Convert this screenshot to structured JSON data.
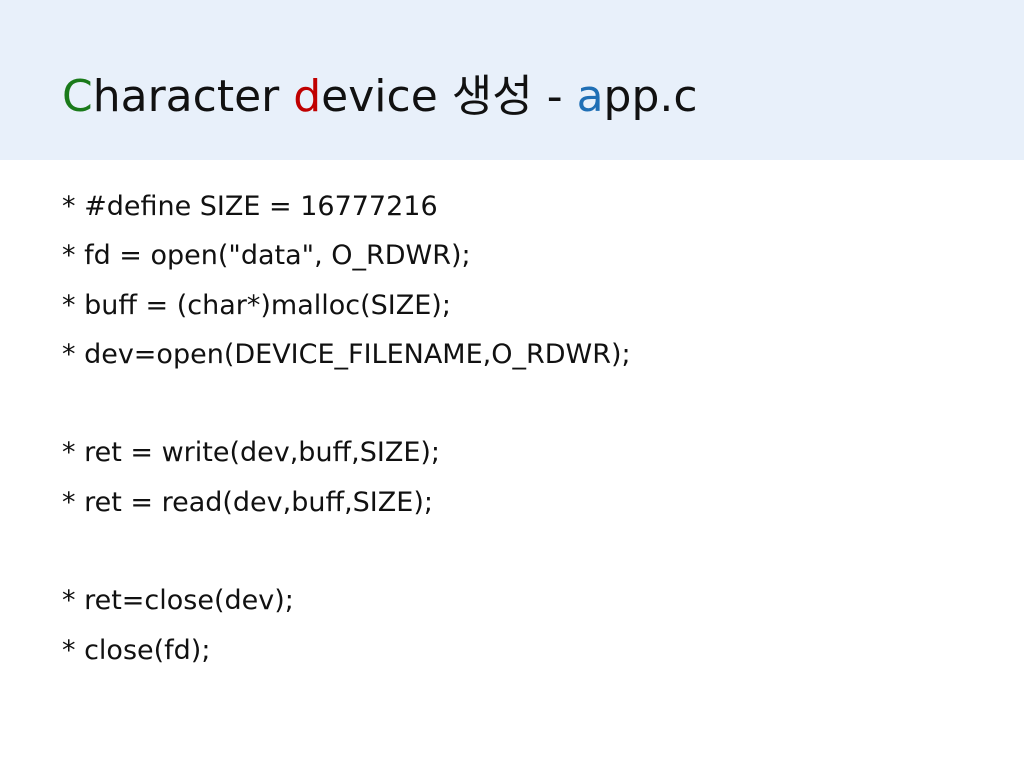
{
  "slide": {
    "title": {
      "parts": [
        {
          "text": "C",
          "color": "#1a7a1a"
        },
        {
          "text": "haracter ",
          "color": "#111111"
        },
        {
          "text": "d",
          "color": "#c00000"
        },
        {
          "text": "evice 생성 - ",
          "color": "#111111"
        },
        {
          "text": "a",
          "color": "#1f6fb5"
        },
        {
          "text": "pp.c",
          "color": "#111111"
        }
      ]
    },
    "lines": [
      "* #define SIZE = 16777216",
      "* fd = open(\"data\", O_RDWR);",
      "* buff = (char*)malloc(SIZE);",
      "* dev=open(DEVICE_FILENAME,O_RDWR);",
      "",
      "* ret = write(dev,buff,SIZE);",
      "* ret = read(dev,buff,SIZE);",
      "",
      "* ret=close(dev);",
      "* close(fd);"
    ],
    "colors": {
      "title_band": "#e8f0fa",
      "text": "#111111"
    }
  }
}
